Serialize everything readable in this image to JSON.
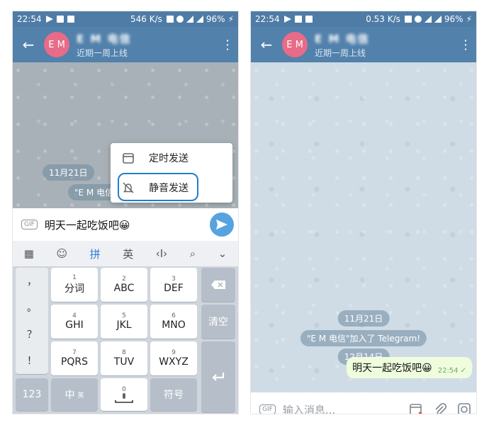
{
  "left": {
    "status": {
      "time": "22:54",
      "speed": "546 K/s",
      "battery": "96%"
    },
    "header": {
      "name": "E M 电信",
      "avatar": "E M",
      "status": "近期一周上线"
    },
    "chip_date": "11月21日",
    "chip_join": "\"E M 电信\"加入了 Telegram!",
    "popup": {
      "schedule": "定时发送",
      "silent": "静音发送"
    },
    "input": {
      "gif": "GIF",
      "text": "明天一起吃饭吧😀"
    },
    "ime": {
      "pinyin": "拼",
      "english": "英",
      "cursor": "‹I›"
    },
    "keys": {
      "comma": "，",
      "dot": "。",
      "question": "？",
      "excl": "！",
      "k1": "分词",
      "k1n": "1",
      "k2": "ABC",
      "k2n": "2",
      "k3": "DEF",
      "k3n": "3",
      "k4": "GHI",
      "k4n": "4",
      "k5": "JKL",
      "k5n": "5",
      "k6": "MNO",
      "k6n": "6",
      "k7": "PQRS",
      "k7n": "7",
      "k8": "TUV",
      "k8n": "8",
      "k9": "WXYZ",
      "k9n": "9",
      "clear": "清空",
      "num": "123",
      "zh": "中",
      "zh_sub": "英",
      "zero": "0",
      "symbol": "符号"
    }
  },
  "right": {
    "status": {
      "time": "22:54",
      "speed": "0.53 K/s",
      "battery": "96%"
    },
    "header": {
      "name": "E M 电信",
      "avatar": "E M",
      "status": "近期一周上线"
    },
    "chip_date1": "11月21日",
    "chip_join": "\"E M 电信\"加入了 Telegram!",
    "chip_date2": "12月14日",
    "message": {
      "text": "明天一起吃饭吧😀",
      "time": "22:54"
    },
    "input": {
      "gif": "GIF",
      "placeholder": "输入消息..."
    }
  }
}
